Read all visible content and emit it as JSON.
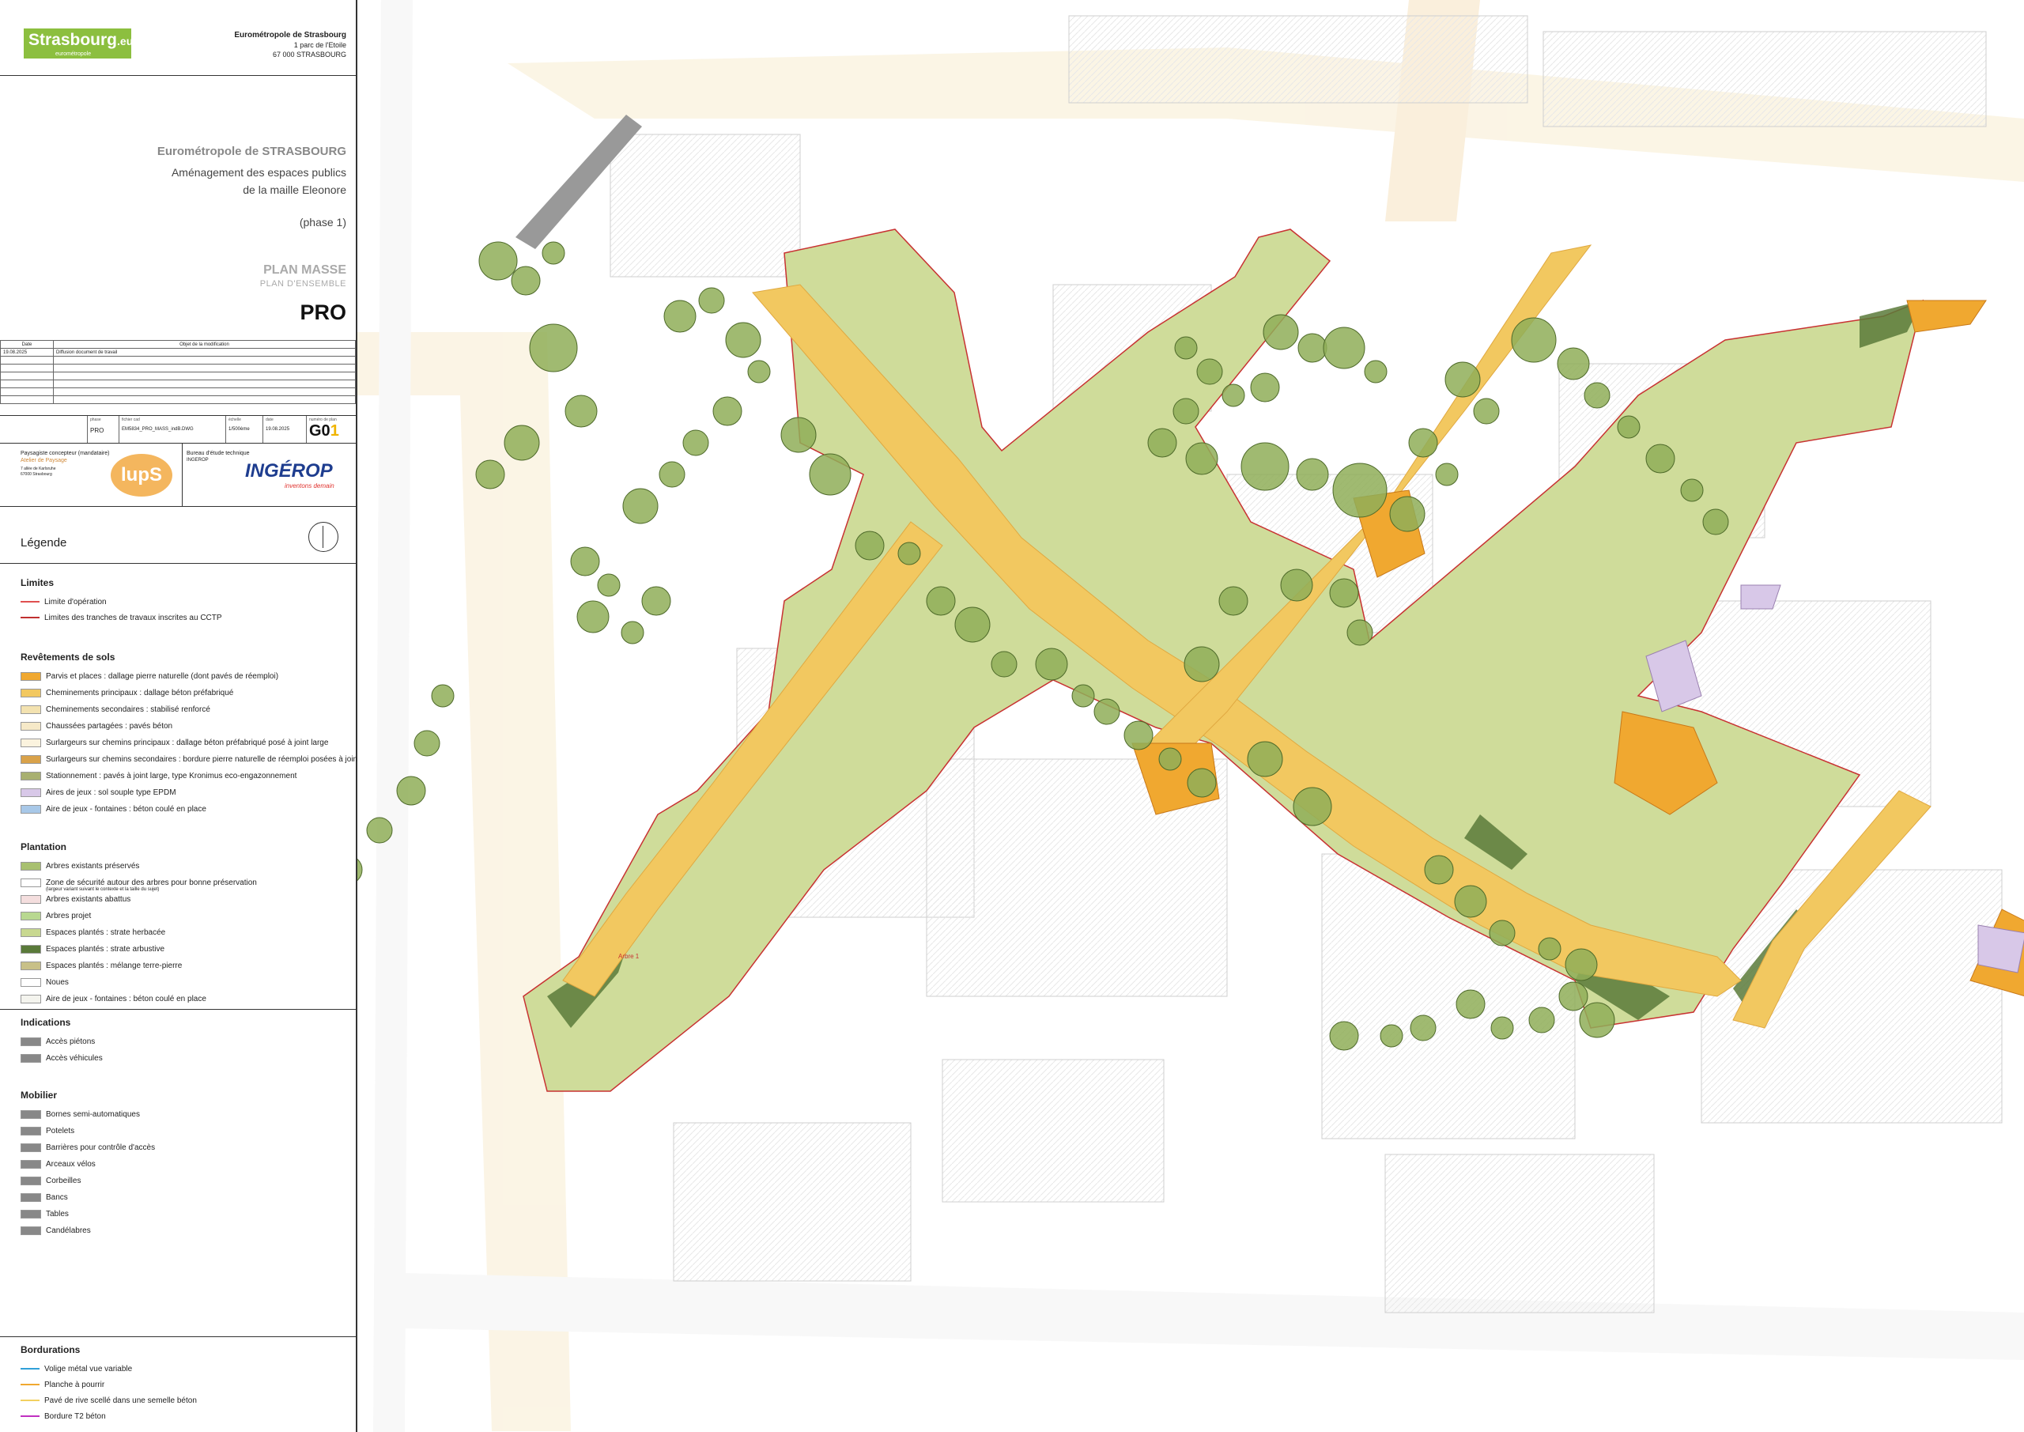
{
  "header": {
    "logo_text": "Strasbourg",
    "logo_suffix": ".eu",
    "logo_sub": "eurométropole",
    "org_name": "Eurométropole de Strasbourg",
    "org_address1": "1 parc de l'Etoile",
    "org_address2": "67 000 STRASBOURG"
  },
  "title": {
    "client": "Eurométropole de STRASBOURG",
    "project_line1": "Aménagement des espaces publics",
    "project_line2": "de la maille Eleonore",
    "phase": "(phase 1)",
    "plan_type": "PLAN MASSE",
    "plan_sub": "PLAN D'ENSEMBLE",
    "stage": "PRO"
  },
  "revisions": {
    "col_date": "Date",
    "col_object": "Objet de la modification",
    "rows": [
      {
        "date": "19.08.2025",
        "object": "Diffusion document de travail"
      }
    ]
  },
  "id_block": {
    "phase_label": "phase",
    "phase_value": "PRO",
    "file_label": "fichier cad",
    "file_value": "EM5834_PRO_MASS_indB.DWG",
    "scale_label": "échelle",
    "scale_value": "1/500ème",
    "date_label": "date",
    "date_value": "19.08.2025",
    "plan_label": "numéro de plan",
    "plan_value_main": "G0",
    "plan_value_index": "1"
  },
  "team": {
    "landscape_label": "Paysagiste concepteur (mandataire)",
    "landscape_sub": "Atelier de Paysage",
    "landscape_logo": "lupS",
    "landscape_addr1": "7 allée de Karlsruhe",
    "landscape_addr2": "67000 Strasbourg",
    "engineer_label": "Bureau d'étude technique",
    "engineer_name": "INGEROP",
    "engineer_logo": "INGÉROP",
    "engineer_tagline": "inventons demain"
  },
  "legend": {
    "title": "Légende",
    "limites": {
      "title": "Limites",
      "items": [
        "Limite d'opération",
        "Limites des tranches de travaux inscrites au CCTP"
      ],
      "colors": [
        "#e05050",
        "#c03030"
      ]
    },
    "revetements": {
      "title": "Revêtements de sols",
      "items": [
        "Parvis et places : dallage pierre naturelle (dont pavés de réemploi)",
        "Cheminements principaux : dallage béton préfabriqué",
        "Cheminements secondaires : stabilisé renforcé",
        "Chaussées partagées : pavés béton",
        "Surlargeurs sur chemins principaux : dallage béton préfabriqué posé à joint large",
        "Surlargeurs sur chemins secondaires : bordure pierre naturelle de réemploi posées à joint large",
        "Stationnement : pavés à joint large, type Kronimus eco-engazonnement",
        "Aires de jeux : sol souple type EPDM",
        "Aire de jeux - fontaines : béton coulé en place"
      ],
      "colors": [
        "#f0a830",
        "#f2c860",
        "#f3e2b0",
        "#f6e9c8",
        "#fbf3de",
        "#d9a24a",
        "#a8b070",
        "#d8c8e8",
        "#a8c8e8"
      ]
    },
    "plantation": {
      "title": "Plantation",
      "items": [
        "Arbres existants préservés",
        "Zone de sécurité autour des arbres pour bonne préservation",
        "Arbres existants abattus",
        "Arbres projet",
        "Espaces plantés : strate herbacée",
        "Espaces plantés : strate arbustive",
        "Espaces plantés : mélange terre-pierre",
        "Noues",
        "Aire de jeux - fontaines : béton coulé en place"
      ],
      "zone_note": "(largeur variant suivant le contexte et la taille du sujet)",
      "colors": [
        "#a8c070",
        "#ffffff",
        "#f4dede",
        "#b8d890",
        "#c8d890",
        "#5a7a3a",
        "#c8c088",
        "#ffffff",
        "#f4f4ee"
      ]
    },
    "indications": {
      "title": "Indications",
      "items": [
        "Accès piétons",
        "Accès véhicules"
      ]
    },
    "mobilier": {
      "title": "Mobilier",
      "items": [
        "Bornes semi-automatiques",
        "Potelets",
        "Barrières pour contrôle d'accès",
        "Arceaux vélos",
        "Corbeilles",
        "Bancs",
        "Tables",
        "Candélabres"
      ]
    },
    "bordurations": {
      "title": "Bordurations",
      "items": [
        "Volige métal vue variable",
        "Planche à pourrir",
        "Pavé de rive scellé dans une semelle béton",
        "Bordure T2 béton"
      ],
      "colors": [
        "#30a0d8",
        "#f0a830",
        "#f2d060",
        "#c030c0"
      ]
    }
  },
  "map": {
    "labels": [
      "Arbre 1"
    ],
    "colors": {
      "parvis": "#f0a830",
      "main_path": "#f2c860",
      "grass": "#c8d890",
      "shrub": "#5a7a3a",
      "tree": "#a8c070",
      "play": "#d8c8e8",
      "road": "#f8ecd0",
      "building": "#bbbbbb"
    }
  }
}
